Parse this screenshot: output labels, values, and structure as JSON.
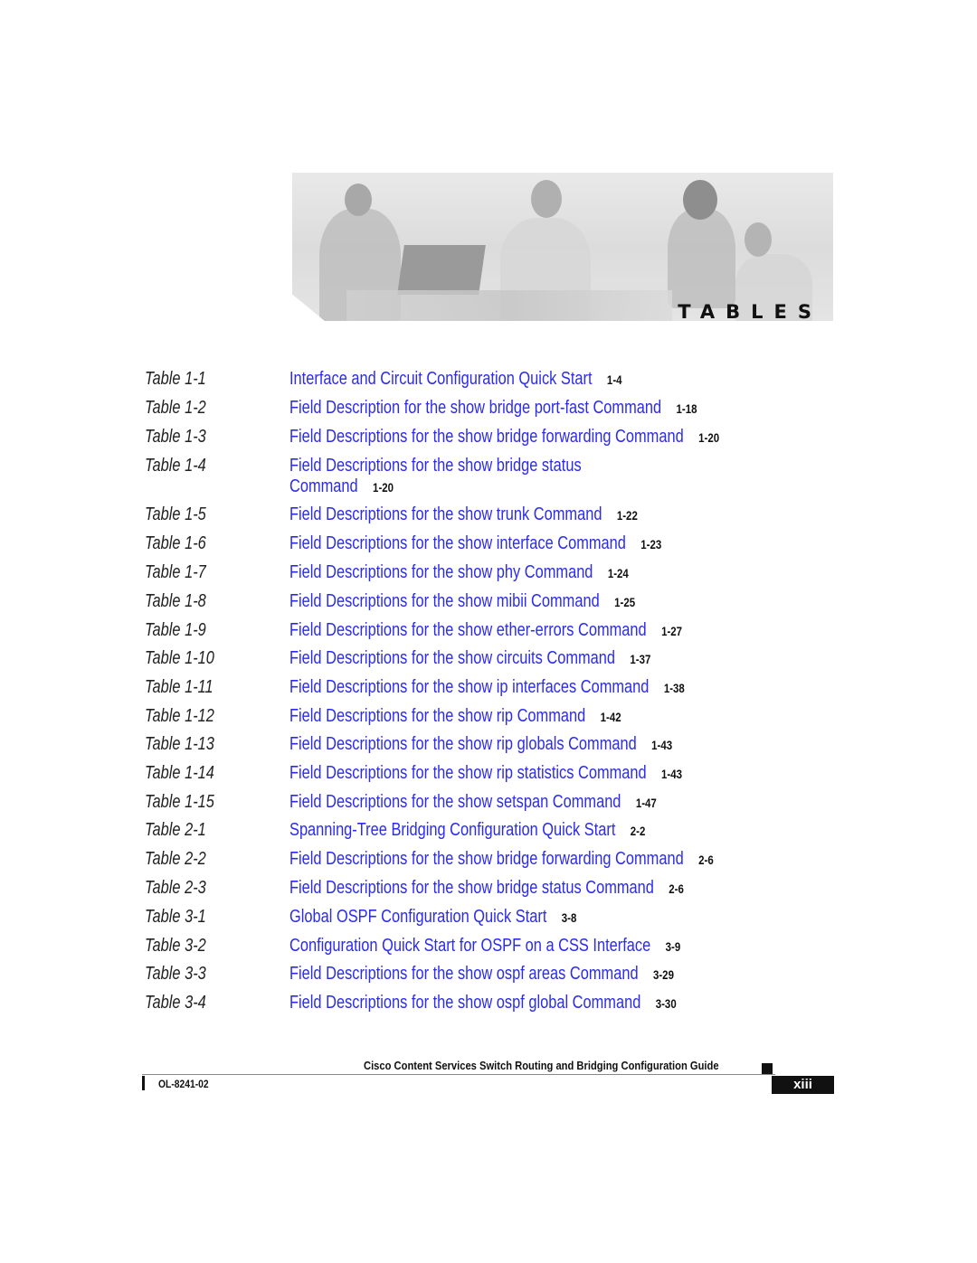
{
  "banner": {
    "title": "TABLES",
    "image_alt": "Four people working with laptop and documents"
  },
  "entries": [
    {
      "label": "Table 1-1",
      "title": "Interface and Circuit Configuration Quick Start",
      "page": "1-4"
    },
    {
      "label": "Table 1-2",
      "title": "Field Description for the show bridge port-fast Command",
      "page": "1-18"
    },
    {
      "label": "Table 1-3",
      "title": "Field Descriptions for the show bridge forwarding Command",
      "page": "1-20"
    },
    {
      "label": "Table 1-4",
      "title": "Field Descriptions for the show bridge status",
      "title2": "Command",
      "page": "1-20"
    },
    {
      "label": "Table 1-5",
      "title": "Field Descriptions for the show trunk Command",
      "page": "1-22"
    },
    {
      "label": "Table 1-6",
      "title": "Field Descriptions for the show interface Command",
      "page": "1-23"
    },
    {
      "label": "Table 1-7",
      "title": "Field Descriptions for the show phy Command",
      "page": "1-24"
    },
    {
      "label": "Table 1-8",
      "title": "Field Descriptions for the show mibii Command",
      "page": "1-25"
    },
    {
      "label": "Table 1-9",
      "title": "Field Descriptions for the show ether-errors Command",
      "page": "1-27"
    },
    {
      "label": "Table 1-10",
      "title": "Field Descriptions for the show circuits Command",
      "page": "1-37"
    },
    {
      "label": "Table 1-11",
      "title": "Field Descriptions for the show ip interfaces Command",
      "page": "1-38"
    },
    {
      "label": "Table 1-12",
      "title": "Field Descriptions for the show rip Command",
      "page": "1-42"
    },
    {
      "label": "Table 1-13",
      "title": "Field Descriptions for the show rip globals Command",
      "page": "1-43"
    },
    {
      "label": "Table 1-14",
      "title": "Field Descriptions for the show rip statistics Command",
      "page": "1-43"
    },
    {
      "label": "Table 1-15",
      "title": "Field Descriptions for the show setspan Command",
      "page": "1-47"
    },
    {
      "label": "Table 2-1",
      "title": "Spanning-Tree Bridging Configuration Quick Start",
      "page": "2-2"
    },
    {
      "label": "Table 2-2",
      "title": "Field Descriptions for the show bridge forwarding Command",
      "page": "2-6"
    },
    {
      "label": "Table 2-3",
      "title": "Field Descriptions for the show bridge status Command",
      "page": "2-6"
    },
    {
      "label": "Table 3-1",
      "title": "Global OSPF Configuration Quick Start",
      "page": "3-8"
    },
    {
      "label": "Table 3-2",
      "title": "Configuration Quick Start for OSPF on a CSS Interface",
      "page": "3-9"
    },
    {
      "label": "Table 3-3",
      "title": "Field Descriptions for the show ospf areas Command",
      "page": "3-29"
    },
    {
      "label": "Table 3-4",
      "title": "Field Descriptions for the show ospf global Command",
      "page": "3-30"
    }
  ],
  "footer": {
    "guide_title": "Cisco Content Services Switch Routing and Bridging Configuration Guide",
    "doc_number": "OL-8241-02",
    "page_number": "xiii"
  },
  "colors": {
    "link": "#2b2bf0",
    "text": "#111111"
  }
}
